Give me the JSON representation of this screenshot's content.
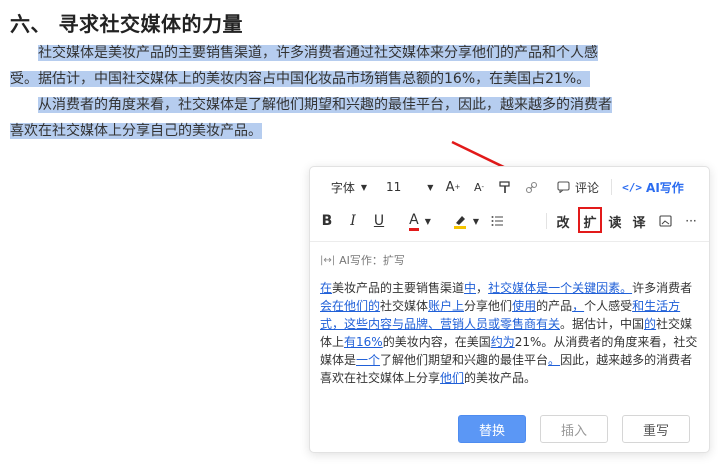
{
  "doc": {
    "heading": "六、 寻求社交媒体的力量",
    "para1": "社交媒体是美妆产品的主要销售渠道，许多消费者通过社交媒体来分享他们的产品和个人感受。据估计，中国社交媒体上的美妆内容占中国化妆品市场销售总额的16%，在美国占21%。",
    "para2": "从消费者的角度来看，社交媒体是了解他们期望和兴趣的最佳平台，因此，越来越多的消费者喜欢在社交媒体上分享自己的美妆产品。"
  },
  "toolbar": {
    "font_family": "字体",
    "font_size": "11",
    "increase_font": "A",
    "decrease_font": "A",
    "comment": "评论",
    "ai_write": "AI写作",
    "bold": "B",
    "italic": "I",
    "underline": "U",
    "font_color": "A",
    "revise": "改",
    "expand": "扩",
    "read": "读",
    "translate": "译"
  },
  "ai_panel": {
    "label": "AI写作：扩写",
    "segments": [
      {
        "t": "在",
        "m": true
      },
      {
        "t": "美妆产品的主要销售渠道",
        "m": false
      },
      {
        "t": "中",
        "m": true
      },
      {
        "t": "，",
        "m": false
      },
      {
        "t": "社交媒体是一个关键因素。",
        "m": true
      },
      {
        "t": "许多消费者",
        "m": false
      },
      {
        "t": "会在他们的",
        "m": true
      },
      {
        "t": "社交媒体",
        "m": false
      },
      {
        "t": "账户上",
        "m": true
      },
      {
        "t": "分享他们",
        "m": false
      },
      {
        "t": "使用",
        "m": true
      },
      {
        "t": "的产品",
        "m": false
      },
      {
        "t": "，",
        "m": true
      },
      {
        "t": "个人感受",
        "m": false
      },
      {
        "t": "和生活方式，这些内容与品牌、营销人员或零售商有关",
        "m": true
      },
      {
        "t": "。据估计，中国",
        "m": false
      },
      {
        "t": "的",
        "m": true
      },
      {
        "t": "社交媒体上",
        "m": false
      },
      {
        "t": "有16%",
        "m": true
      },
      {
        "t": "的美妆内容，在美国",
        "m": false
      },
      {
        "t": "约为",
        "m": true
      },
      {
        "t": "21%。从消费者的角度来看，社交媒体是",
        "m": false
      },
      {
        "t": "一个",
        "m": true
      },
      {
        "t": "了解他们期望和兴趣的最佳平台",
        "m": false
      },
      {
        "t": "。",
        "m": true
      },
      {
        "t": "因此，越来越多的消费者喜欢在社交媒体上分享",
        "m": false
      },
      {
        "t": "他们",
        "m": true
      },
      {
        "t": "的美妆产品。",
        "m": false
      }
    ],
    "replace_label": "替换",
    "insert_label": "插入",
    "rewrite_label": "重写"
  },
  "colors": {
    "selection": "#b6cdef",
    "accent": "#2b6cf0",
    "highlight_box": "#e21a1a",
    "primary_button": "#5b97f5"
  }
}
